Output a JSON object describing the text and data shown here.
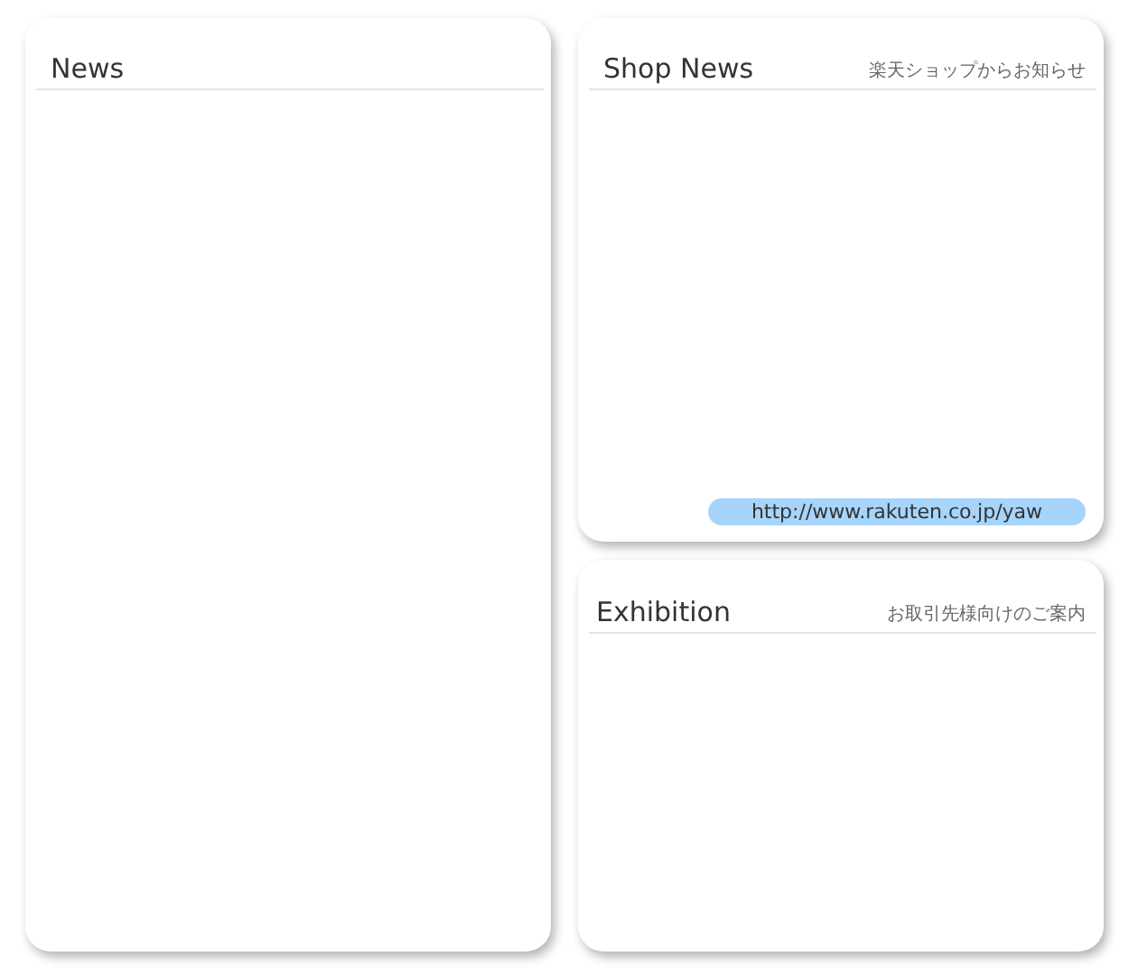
{
  "news": {
    "title": "News"
  },
  "shop_news": {
    "title": "Shop News",
    "subtitle": "楽天ショップからお知らせ",
    "link": "http://www.rakuten.co.jp/yaw"
  },
  "exhibition": {
    "title": "Exhibition",
    "subtitle": "お取引先様向けのご案内"
  }
}
